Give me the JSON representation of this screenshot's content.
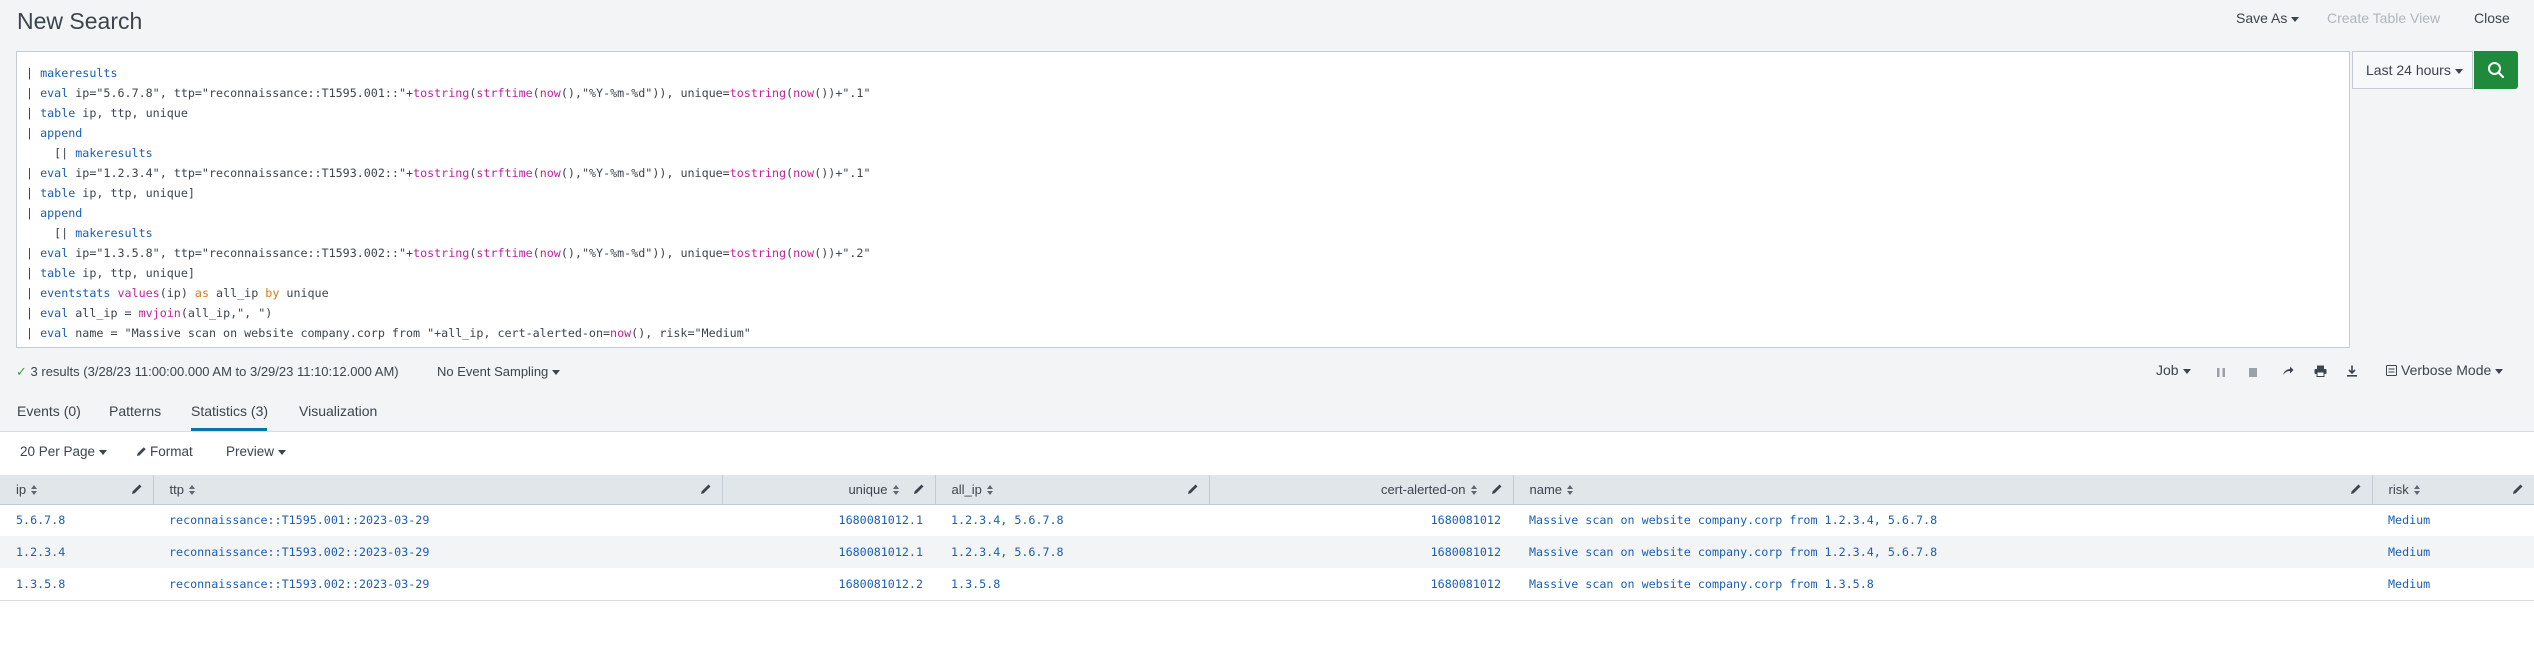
{
  "header": {
    "title": "New Search",
    "save_as": "Save As",
    "create_table_view": "Create Table View",
    "close": "Close"
  },
  "search": {
    "lines": [
      [
        [
          "| ",
          "pipe"
        ],
        [
          "makeresults",
          "cmd"
        ]
      ],
      [
        [
          "| ",
          "pipe"
        ],
        [
          "eval",
          "cmd"
        ],
        [
          " ip=\"5.6.7.8\", ttp=\"reconnaissance::T1595.001::\"+",
          "str"
        ],
        [
          "tostring",
          "fn"
        ],
        [
          "(",
          "str"
        ],
        [
          "strftime",
          "fn"
        ],
        [
          "(",
          "str"
        ],
        [
          "now",
          "fn"
        ],
        [
          "(),\"%Y-%m-%d\")), unique=",
          "str"
        ],
        [
          "tostring",
          "fn"
        ],
        [
          "(",
          "str"
        ],
        [
          "now",
          "fn"
        ],
        [
          "())+\".1\"",
          "str"
        ]
      ],
      [
        [
          "| ",
          "pipe"
        ],
        [
          "table",
          "cmd"
        ],
        [
          " ip, ttp, unique",
          "str"
        ]
      ],
      [
        [
          "| ",
          "pipe"
        ],
        [
          "append",
          "cmd"
        ]
      ],
      [
        [
          "    [| ",
          "pipe"
        ],
        [
          "makeresults",
          "cmd"
        ]
      ],
      [
        [
          "| ",
          "pipe"
        ],
        [
          "eval",
          "cmd"
        ],
        [
          " ip=\"1.2.3.4\", ttp=\"reconnaissance::T1593.002::\"+",
          "str"
        ],
        [
          "tostring",
          "fn"
        ],
        [
          "(",
          "str"
        ],
        [
          "strftime",
          "fn"
        ],
        [
          "(",
          "str"
        ],
        [
          "now",
          "fn"
        ],
        [
          "(),\"%Y-%m-%d\")), unique=",
          "str"
        ],
        [
          "tostring",
          "fn"
        ],
        [
          "(",
          "str"
        ],
        [
          "now",
          "fn"
        ],
        [
          "())+\".1\"",
          "str"
        ]
      ],
      [
        [
          "| ",
          "pipe"
        ],
        [
          "table",
          "cmd"
        ],
        [
          " ip, ttp, unique]",
          "str"
        ]
      ],
      [
        [
          "| ",
          "pipe"
        ],
        [
          "append",
          "cmd"
        ]
      ],
      [
        [
          "    [| ",
          "pipe"
        ],
        [
          "makeresults",
          "cmd"
        ]
      ],
      [
        [
          "| ",
          "pipe"
        ],
        [
          "eval",
          "cmd"
        ],
        [
          " ip=\"1.3.5.8\", ttp=\"reconnaissance::T1593.002::\"+",
          "str"
        ],
        [
          "tostring",
          "fn"
        ],
        [
          "(",
          "str"
        ],
        [
          "strftime",
          "fn"
        ],
        [
          "(",
          "str"
        ],
        [
          "now",
          "fn"
        ],
        [
          "(),\"%Y-%m-%d\")), unique=",
          "str"
        ],
        [
          "tostring",
          "fn"
        ],
        [
          "(",
          "str"
        ],
        [
          "now",
          "fn"
        ],
        [
          "())+\".2\"",
          "str"
        ]
      ],
      [
        [
          "| ",
          "pipe"
        ],
        [
          "table",
          "cmd"
        ],
        [
          " ip, ttp, unique]",
          "str"
        ]
      ],
      [
        [
          "| ",
          "pipe"
        ],
        [
          "eventstats",
          "cmd"
        ],
        [
          " ",
          "str"
        ],
        [
          "values",
          "fn"
        ],
        [
          "(ip) ",
          "str"
        ],
        [
          "as",
          "kw"
        ],
        [
          " all_ip ",
          "str"
        ],
        [
          "by",
          "kw"
        ],
        [
          " unique",
          "str"
        ]
      ],
      [
        [
          "| ",
          "pipe"
        ],
        [
          "eval",
          "cmd"
        ],
        [
          " all_ip = ",
          "str"
        ],
        [
          "mvjoin",
          "fn"
        ],
        [
          "(all_ip,\", \")",
          "str"
        ]
      ],
      [
        [
          "| ",
          "pipe"
        ],
        [
          "eval",
          "cmd"
        ],
        [
          " name = \"Massive scan on website company.corp from \"+all_ip, cert-alerted-on=",
          "str"
        ],
        [
          "now",
          "fn"
        ],
        [
          "(), risk=\"Medium\"",
          "str"
        ]
      ]
    ],
    "time_range": "Last 24 hours"
  },
  "status": {
    "results": "3 results (3/28/23 11:00:00.000 AM to 3/29/23 11:10:12.000 AM)",
    "sampling": "No Event Sampling",
    "job": "Job",
    "mode": "Verbose Mode"
  },
  "tabs": [
    {
      "label": "Events (0)"
    },
    {
      "label": "Patterns"
    },
    {
      "label": "Statistics (3)"
    },
    {
      "label": "Visualization"
    }
  ],
  "controls": {
    "per_page": "20 Per Page",
    "format": "Format",
    "preview": "Preview"
  },
  "table": {
    "columns": [
      "ip",
      "ttp",
      "unique",
      "all_ip",
      "cert-alerted-on",
      "name",
      "risk"
    ],
    "rows": [
      [
        "5.6.7.8",
        "reconnaissance::T1595.001::2023-03-29",
        "1680081012.1",
        "1.2.3.4, 5.6.7.8",
        "1680081012",
        "Massive scan on website company.corp from 1.2.3.4, 5.6.7.8",
        "Medium"
      ],
      [
        "1.2.3.4",
        "reconnaissance::T1593.002::2023-03-29",
        "1680081012.1",
        "1.2.3.4, 5.6.7.8",
        "1680081012",
        "Massive scan on website company.corp from 1.2.3.4, 5.6.7.8",
        "Medium"
      ],
      [
        "1.3.5.8",
        "reconnaissance::T1593.002::2023-03-29",
        "1680081012.2",
        "1.3.5.8",
        "1680081012",
        "Massive scan on website company.corp from 1.3.5.8",
        "Medium"
      ]
    ]
  },
  "colors": {
    "accent_green": "#1f8a3b",
    "link_blue": "#1a5fb4",
    "command_blue": "#1a5fb4",
    "function_magenta": "#c1239f",
    "keyword_orange": "#d97a1a",
    "tab_underline": "#0877a6"
  }
}
